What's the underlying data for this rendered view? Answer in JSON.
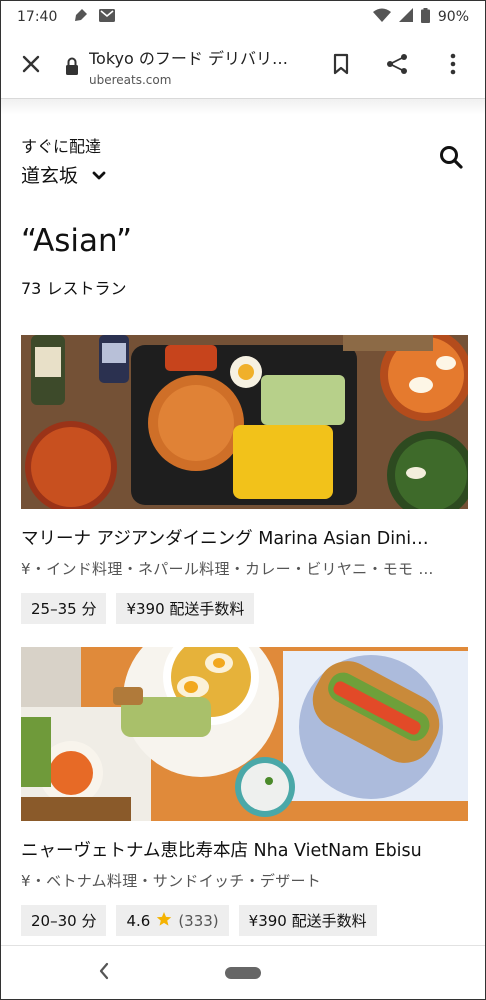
{
  "status_bar": {
    "time": "17:40",
    "battery": "90%"
  },
  "browser": {
    "page_title": "Tokyo のフード デリバリ…",
    "domain": "ubereats.com"
  },
  "header": {
    "delivery_label": "すぐに配達",
    "location": "道玄坂"
  },
  "search": {
    "query": "“Asian”",
    "result_count": "73 レストラン"
  },
  "restaurants": [
    {
      "name": "マリーナ アジアンダイニング Marina Asian Dini…",
      "categories": "¥・インド料理・ネパール料理・カレー・ビリヤニ・モモ …",
      "chips": [
        "25–35 分",
        "¥390 配送手数料"
      ]
    },
    {
      "name": "ニャーヴェトナム恵比寿本店 Nha VietNam Ebisu",
      "categories": "¥・ベトナム料理・サンドイッチ・デザート",
      "time": "20–30 分",
      "rating": "4.6",
      "rating_count": "(333)",
      "fee": "¥390 配送手数料"
    }
  ],
  "icons": {
    "close": "close-icon",
    "lock": "lock-icon",
    "bookmark": "bookmark-icon",
    "share": "share-icon",
    "menu": "more-vert-icon",
    "search": "search-icon",
    "chevron": "chevron-down-icon",
    "star": "star-icon",
    "back": "back-icon"
  },
  "colors": {
    "star": "#f5b301",
    "chip_bg": "#eeeeee"
  }
}
